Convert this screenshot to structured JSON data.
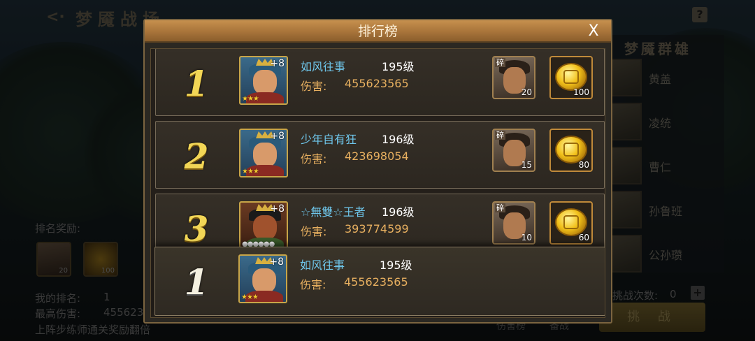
{
  "background": {
    "title": "梦魇战场",
    "back_icon": "back-arrow-icon",
    "help_icon_label": "?",
    "right_panel": {
      "title": "梦魇群雄",
      "heroes": [
        "黄盖",
        "凌统",
        "曹仁",
        "孙鲁班",
        "公孙瓒"
      ]
    },
    "rank_reward_label": "排名奖励:",
    "rank_reward_items": [
      {
        "type": "fragment",
        "count": "20"
      },
      {
        "type": "gold",
        "count": "100"
      }
    ],
    "my_rank_label": "我的排名:",
    "my_rank_value": "1",
    "best_damage_label": "最高伤害:",
    "best_damage_value": "455623",
    "bonus_text": "上阵步练师通关奖励翻倍",
    "challenge_count_label": "挑战次数:",
    "challenge_count_value": "0",
    "plus_label": "+",
    "challenge_button": "挑 战",
    "tab_damage": "伤害榜",
    "tab_lineup": "备战"
  },
  "modal": {
    "title": "排行榜",
    "close_label": "X",
    "entries": [
      {
        "rank": "1",
        "name": "如风往事",
        "level": "195级",
        "damage_label": "伤害:",
        "damage": "455623565",
        "avatar_plus": "+8",
        "avatar_style": "blue",
        "stars": "★★★",
        "rewards": {
          "fragment_count": "20",
          "gold_count": "100",
          "fragment_mark": "碎"
        }
      },
      {
        "rank": "2",
        "name": "少年自有狂",
        "level": "196级",
        "damage_label": "伤害:",
        "damage": "423698054",
        "avatar_plus": "+8",
        "avatar_style": "blue",
        "stars": "★★★",
        "rewards": {
          "fragment_count": "15",
          "gold_count": "80",
          "fragment_mark": "碎"
        }
      },
      {
        "rank": "3",
        "name": "☆無雙☆王者",
        "level": "196级",
        "damage_label": "伤害:",
        "damage": "393774599",
        "avatar_plus": "+8",
        "avatar_style": "red",
        "stars": "●●●●●●",
        "rewards": {
          "fragment_count": "10",
          "gold_count": "60",
          "fragment_mark": "碎"
        }
      }
    ],
    "self_entry": {
      "rank": "1",
      "name": "如风往事",
      "level": "195级",
      "damage_label": "伤害:",
      "damage": "455623565",
      "avatar_plus": "+8",
      "stars": "★★★"
    }
  }
}
